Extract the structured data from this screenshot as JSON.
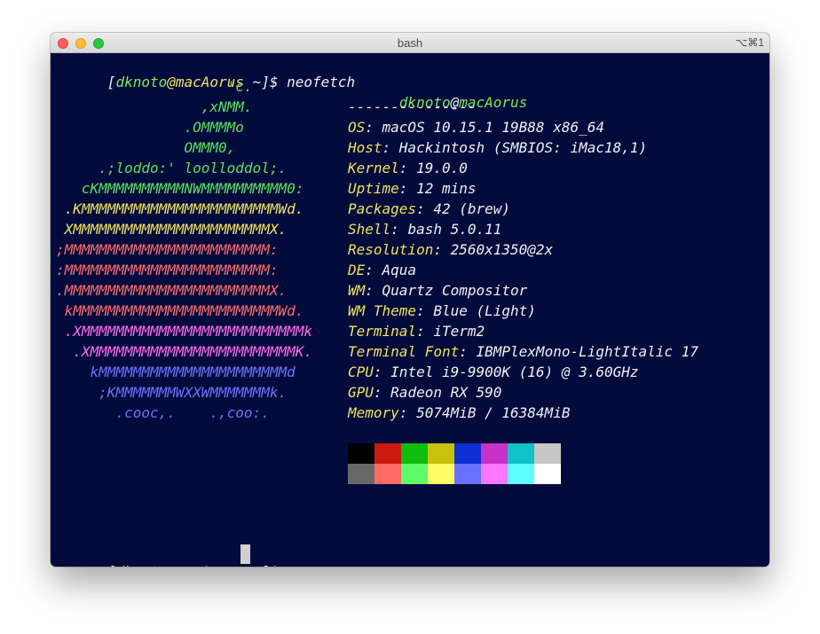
{
  "window": {
    "title": "bash",
    "shortcut": "⌥⌘1"
  },
  "prompt": {
    "open": "[",
    "user": "dknoto",
    "at": "@",
    "host": "macAorus",
    "rest": " ~]$ ",
    "command": "neofetch"
  },
  "art": [
    {
      "text": "                    'c.",
      "color": "green"
    },
    {
      "text": "                 ,xNMM.",
      "color": "green"
    },
    {
      "text": "               .OMMMMo",
      "color": "green"
    },
    {
      "text": "               OMMM0,",
      "color": "green"
    },
    {
      "text": "     .;loddo:' loolloddol;.",
      "color": "green"
    },
    {
      "text": "   cKMMMMMMMMMMNWMMMMMMMMMM0:",
      "color": "green"
    },
    {
      "text": " .KMMMMMMMMMMMMMMMMMMMMMMMWd.",
      "color": "yellow"
    },
    {
      "text": " XMMMMMMMMMMMMMMMMMMMMMMMX.",
      "color": "yellow"
    },
    {
      "text": ";MMMMMMMMMMMMMMMMMMMMMMMM:",
      "color": "red"
    },
    {
      "text": ":MMMMMMMMMMMMMMMMMMMMMMMM:",
      "color": "red"
    },
    {
      "text": ".MMMMMMMMMMMMMMMMMMMMMMMMX.",
      "color": "red"
    },
    {
      "text": " kMMMMMMMMMMMMMMMMMMMMMMMMWd.",
      "color": "red"
    },
    {
      "text": " .XMMMMMMMMMMMMMMMMMMMMMMMMMMk",
      "color": "pink"
    },
    {
      "text": "  .XMMMMMMMMMMMMMMMMMMMMMMMMK.",
      "color": "pink"
    },
    {
      "text": "    kMMMMMMMMMMMMMMMMMMMMMMd",
      "color": "blue"
    },
    {
      "text": "     ;KMMMMMMMWXXWMMMMMMMk.",
      "color": "blue"
    },
    {
      "text": "       .cooc,.    .,coo:.",
      "color": "blue"
    }
  ],
  "info_header": {
    "user": "dknoto",
    "at": "@",
    "host": "macAorus",
    "separator": "---------------"
  },
  "info": [
    {
      "key": "OS",
      "value": "macOS 10.15.1 19B88 x86_64"
    },
    {
      "key": "Host",
      "value": "Hackintosh (SMBIOS: iMac18,1)"
    },
    {
      "key": "Kernel",
      "value": "19.0.0"
    },
    {
      "key": "Uptime",
      "value": "12 mins"
    },
    {
      "key": "Packages",
      "value": "42 (brew)"
    },
    {
      "key": "Shell",
      "value": "bash 5.0.11"
    },
    {
      "key": "Resolution",
      "value": "2560x1350@2x"
    },
    {
      "key": "DE",
      "value": "Aqua"
    },
    {
      "key": "WM",
      "value": "Quartz Compositor"
    },
    {
      "key": "WM Theme",
      "value": "Blue (Light)"
    },
    {
      "key": "Terminal",
      "value": "iTerm2"
    },
    {
      "key": "Terminal Font",
      "value": "IBMPlexMono-LightItalic 17"
    },
    {
      "key": "CPU",
      "value": "Intel i9-9900K (16) @ 3.60GHz"
    },
    {
      "key": "GPU",
      "value": "Radeon RX 590"
    },
    {
      "key": "Memory",
      "value": "5074MiB / 16384MiB"
    }
  ],
  "palette": {
    "normal": [
      "#000000",
      "#cc1a0e",
      "#0fbd0f",
      "#c8c00a",
      "#0c2fd4",
      "#c532c5",
      "#0fc2c8",
      "#c7c7c7"
    ],
    "bright": [
      "#686868",
      "#ff6b63",
      "#5ffa68",
      "#fffc67",
      "#6871ff",
      "#ff76ff",
      "#60fdff",
      "#ffffff"
    ]
  },
  "prompt2": {
    "open": "[",
    "user": "dknoto",
    "at": "@",
    "host": "macAorus",
    "rest": " ~]$ "
  }
}
